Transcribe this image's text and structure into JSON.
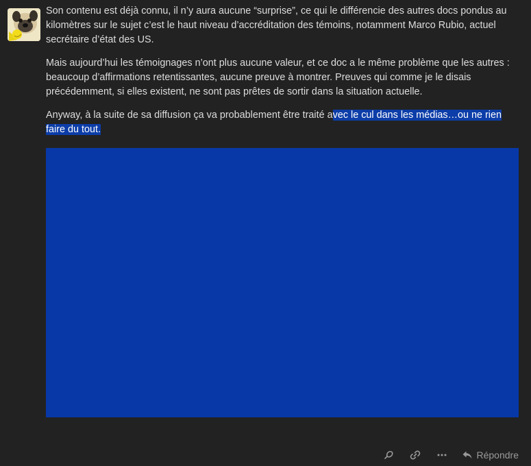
{
  "post": {
    "avatar_icon": "pug-avatar",
    "paragraphs": [
      "Son contenu est déjà connu, il n’y aura aucune “surprise”, ce qui le différencie des autres docs pondus au kilomètres sur le sujet c’est le haut niveau d’accréditation des témoins, notamment Marco Rubio, actuel secrétaire d’état des US.",
      "Mais aujourd’hui les témoignages n’ont plus aucune valeur, et ce doc a le même problème que les autres : beaucoup d’affirmations retentissantes, aucune preuve à montrer. Preuves qui comme je le disais précédemment, si elles existent, ne sont pas prêtes de sortir dans la situation actuelle."
    ],
    "last_paragraph_plain": "Anyway, à la suite de sa diffusion ça va probablement être traité a",
    "last_paragraph_selected": "vec le cul dans les médias…ou ne rien faire du tout.",
    "selection_color": "#0c3da8",
    "media_color": "#0838a8"
  },
  "actions": {
    "like_icon": "heart-icon",
    "link_icon": "link-icon",
    "more_icon": "more-icon",
    "reply_icon": "reply-icon",
    "reply_label": "Répondre"
  }
}
